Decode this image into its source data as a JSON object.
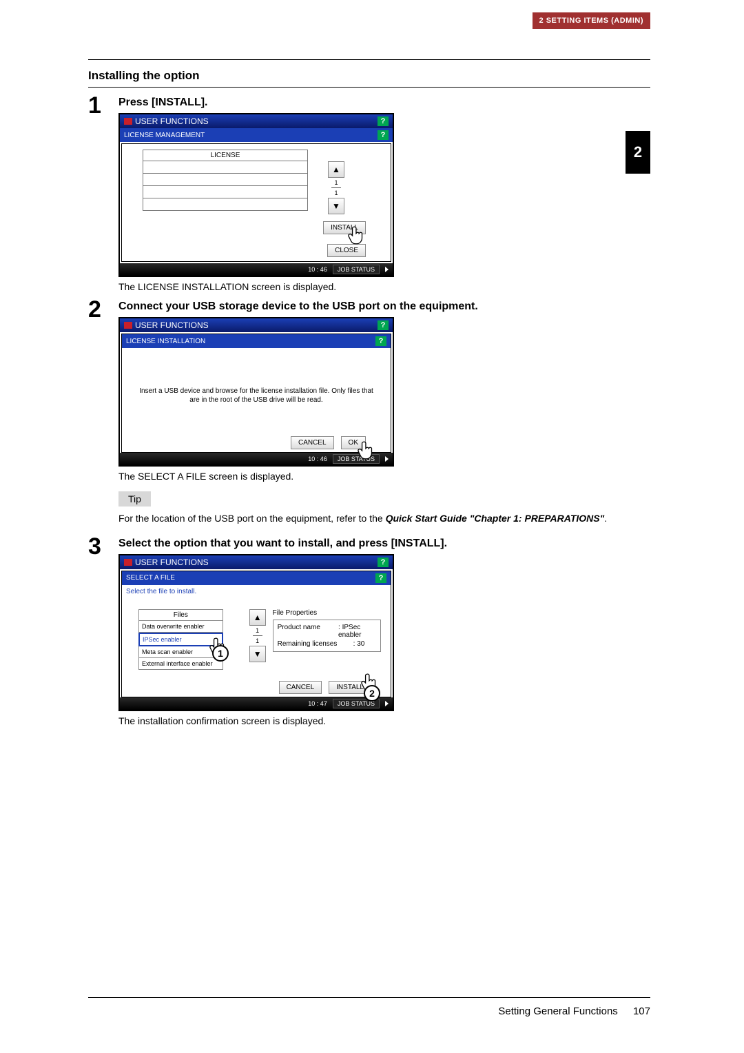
{
  "header_badge": "2 SETTING ITEMS (ADMIN)",
  "chapter_tab": "2",
  "section_title": "Installing the option",
  "steps": [
    {
      "num": "1",
      "heading": "Press [INSTALL].",
      "caption": "The LICENSE INSTALLATION screen is displayed."
    },
    {
      "num": "2",
      "heading": "Connect your USB storage device to the USB port on the equipment.",
      "caption": "The SELECT A FILE screen is displayed."
    },
    {
      "num": "3",
      "heading": "Select the option that you want to install, and press [INSTALL].",
      "caption": "The installation confirmation screen is displayed."
    }
  ],
  "tip": {
    "label": "Tip",
    "text_pre": "For the location of the USB port on the equipment, refer to the ",
    "text_bold": "Quick Start Guide \"Chapter 1: PREPARATIONS\"",
    "text_post": "."
  },
  "panel_common": {
    "title": "USER FUNCTIONS",
    "help": "?",
    "job_status": "JOB STATUS"
  },
  "panel1": {
    "breadcrumb": "LICENSE MANAGEMENT",
    "col_header": "LICENSE",
    "page_cur": "1",
    "page_total": "1",
    "install_btn": "INSTALL",
    "close_btn": "CLOSE",
    "time": "10 : 46"
  },
  "panel2": {
    "breadcrumb": "LICENSE  INSTALLATION",
    "message": "Insert a USB device and browse for the license installation file. Only files that are in the root of the USB drive will be read.",
    "cancel_btn": "CANCEL",
    "ok_btn": "OK",
    "time": "10 : 46"
  },
  "panel3": {
    "breadcrumb": "SELECT A FILE",
    "instruction": "Select the file to install.",
    "files_header": "Files",
    "files": [
      "Data overwrite enabler",
      "IPSec enabler",
      "Meta scan enabler",
      "External interface enabler"
    ],
    "selected_index": 1,
    "page_cur": "1",
    "page_total": "1",
    "props_header": "File Properties",
    "props": [
      {
        "k": "Product name",
        "v": ": IPSec enabler"
      },
      {
        "k": "Remaining licenses",
        "v": ": 30"
      }
    ],
    "cancel_btn": "CANCEL",
    "install_btn": "INSTALL",
    "time": "10 : 47"
  },
  "footer": {
    "text": "Setting General Functions",
    "page": "107"
  }
}
